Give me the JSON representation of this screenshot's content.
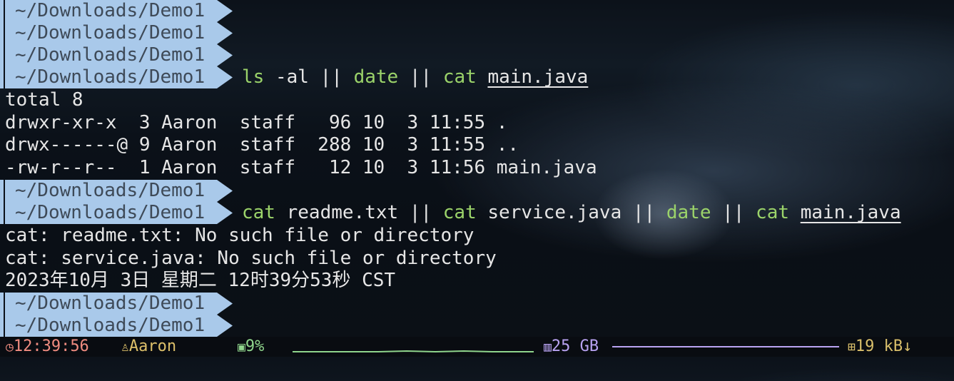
{
  "prompt": "~/Downloads/Demo1",
  "cmd1": {
    "parts": [
      {
        "t": "ls",
        "c": "g"
      },
      {
        "t": " -al "
      },
      {
        "t": "||"
      },
      {
        "t": " "
      },
      {
        "t": "date",
        "c": "g"
      },
      {
        "t": " || "
      },
      {
        "t": "cat",
        "c": "g"
      },
      {
        "t": " "
      },
      {
        "t": "main.java",
        "c": "u"
      }
    ]
  },
  "out1": [
    "total 8",
    "drwxr-xr-x  3 Aaron  staff   96 10  3 11:55 .",
    "drwx------@ 9 Aaron  staff  288 10  3 11:55 ..",
    "-rw-r--r--  1 Aaron  staff   12 10  3 11:56 main.java"
  ],
  "cmd2": {
    "parts": [
      {
        "t": "cat",
        "c": "g"
      },
      {
        "t": " readme.txt || "
      },
      {
        "t": "cat",
        "c": "g"
      },
      {
        "t": " service.java || "
      },
      {
        "t": "date",
        "c": "g"
      },
      {
        "t": " || "
      },
      {
        "t": "cat",
        "c": "g"
      },
      {
        "t": " "
      },
      {
        "t": "main.java",
        "c": "u"
      }
    ]
  },
  "out2": [
    "cat: readme.txt: No such file or directory",
    "cat: service.java: No such file or directory",
    "2023年10月 3日 星期二 12时39分53秒 CST"
  ],
  "status": {
    "clock": "12:39:56",
    "user": "Aaron",
    "cpu": "9%",
    "disk": "25 GB",
    "net": "19 kB↓"
  },
  "colors": {
    "prompt_bg": "#a9c9ea",
    "prompt_fg": "#3e4a58",
    "command": "#9bd36a",
    "clock": "#f08c80",
    "user": "#ddc06a",
    "cpu": "#8fd58c",
    "disk": "#b9a3f2",
    "net": "#d9bf6b"
  }
}
